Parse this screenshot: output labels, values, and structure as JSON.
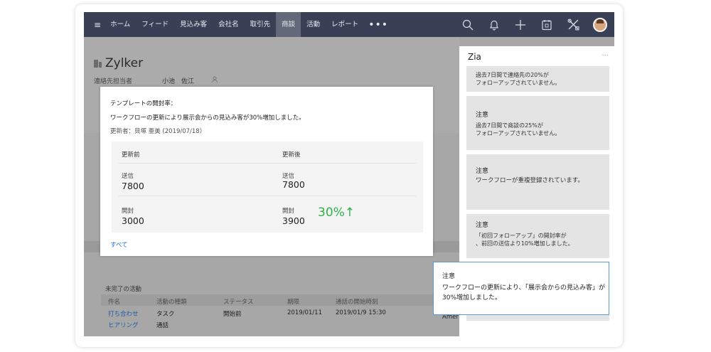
{
  "nav": {
    "items": [
      "ホーム",
      "フィード",
      "見込み客",
      "会社名",
      "取引先",
      "商談",
      "活動",
      "レポート"
    ],
    "active_index": 5,
    "more": "•••"
  },
  "record": {
    "name": "Zylker",
    "owner_label": "連絡先担当者",
    "owner_name": "小池　佐江"
  },
  "card": {
    "title": "テンプレートの開封率：",
    "message": "ワークフローの更新により展示会からの見込み客が30%増加しました。",
    "updated": "更新者：貝塚 亜美 (2019/07/18）",
    "before_header": "更新前",
    "after_header": "更新後",
    "sent_label": "送信",
    "opened_label": "開封",
    "before_sent": "7800",
    "after_sent": "7800",
    "before_opened": "3000",
    "after_opened": "3900",
    "change": "30%↑",
    "all_link": "すべて"
  },
  "activities": {
    "title": "未完了の活動",
    "headers": [
      "件名",
      "活動の種類",
      "ステータス",
      "期限",
      "通話の開始時刻"
    ],
    "rows": [
      [
        "打ち合わせ",
        "タスク",
        "開始前",
        "2019/01/11",
        "2019/01/9 15:30"
      ],
      [
        "ヒアリング",
        "通話",
        "",
        "",
        ""
      ]
    ]
  },
  "zia": {
    "title": "Zia",
    "more": "···",
    "cards": [
      {
        "heading": "",
        "text": [
          "過去7日間で連絡先の20%が",
          "フォローアップされていません。"
        ]
      },
      {
        "heading": "注意",
        "text": [
          "過去7日間で商談の25%が",
          "フォローアップされていません。"
        ]
      },
      {
        "heading": "注意",
        "text": [
          "ワークフローが重複登録されています。"
        ]
      },
      {
        "heading": "注意",
        "text": [
          "「初回フォローアップ」の開封率が",
          "、前回の送信より10%増加しました。"
        ]
      }
    ]
  },
  "tooltip": {
    "heading": "注意",
    "text": "ワークフローの更新により、「展示会からの見込み客」が30%増加しました。"
  },
  "partial_text": "Amer",
  "colors": {
    "nav_bg": "#394055",
    "nav_active": "#636979",
    "link": "#1e5aa8",
    "positive": "#2fb24a",
    "tooltip_border": "#5b9bd5"
  }
}
